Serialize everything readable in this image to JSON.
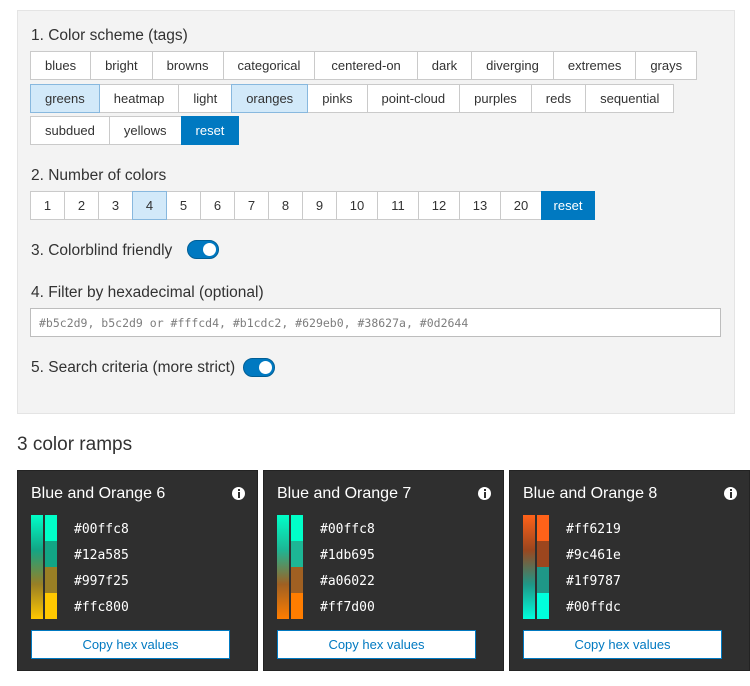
{
  "filters": {
    "scheme_title": "1. Color scheme (tags)",
    "tag_rows": [
      [
        "blues",
        "bright",
        "browns",
        "categorical",
        "centered-on",
        "dark",
        "diverging",
        "extremes",
        "grays"
      ],
      [
        "greens",
        "heatmap",
        "light",
        "oranges",
        "pinks",
        "point-cloud",
        "purples",
        "reds",
        "sequential"
      ],
      [
        "subdued",
        "yellows",
        "reset"
      ]
    ],
    "selected_tags": [
      "greens",
      "oranges"
    ],
    "count_title": "2. Number of colors",
    "counts": [
      "1",
      "2",
      "3",
      "4",
      "5",
      "6",
      "7",
      "8",
      "9",
      "10",
      "11",
      "12",
      "13",
      "20",
      "reset"
    ],
    "selected_count": "4",
    "colorblind_label": "3. Colorblind friendly",
    "colorblind_on": true,
    "hex_label": "4. Filter by hexadecimal (optional)",
    "hex_placeholder": "#b5c2d9, b5c2d9 or #fffcd4, #b1cdc2, #629eb0, #38627a, #0d2644",
    "hex_value": "",
    "strict_label": "5. Search criteria (more strict)",
    "strict_on": true
  },
  "results": {
    "title": "3 color ramps",
    "ramps": [
      {
        "name": "Blue and Orange 6",
        "colors": [
          "#00ffc8",
          "#12a585",
          "#997f25",
          "#ffc800"
        ],
        "copy_label": "Copy hex values"
      },
      {
        "name": "Blue and Orange 7",
        "colors": [
          "#00ffc8",
          "#1db695",
          "#a06022",
          "#ff7d00"
        ],
        "copy_label": "Copy hex values"
      },
      {
        "name": "Blue and Orange 8",
        "colors": [
          "#ff6219",
          "#9c461e",
          "#1f9787",
          "#00ffdc"
        ],
        "copy_label": "Copy hex values"
      }
    ]
  },
  "colors": {
    "accent": "#0079c1",
    "selected_bg": "#d2e9f9",
    "card_bg": "#2f2f2f",
    "panel_bg": "#f3f3f3"
  }
}
